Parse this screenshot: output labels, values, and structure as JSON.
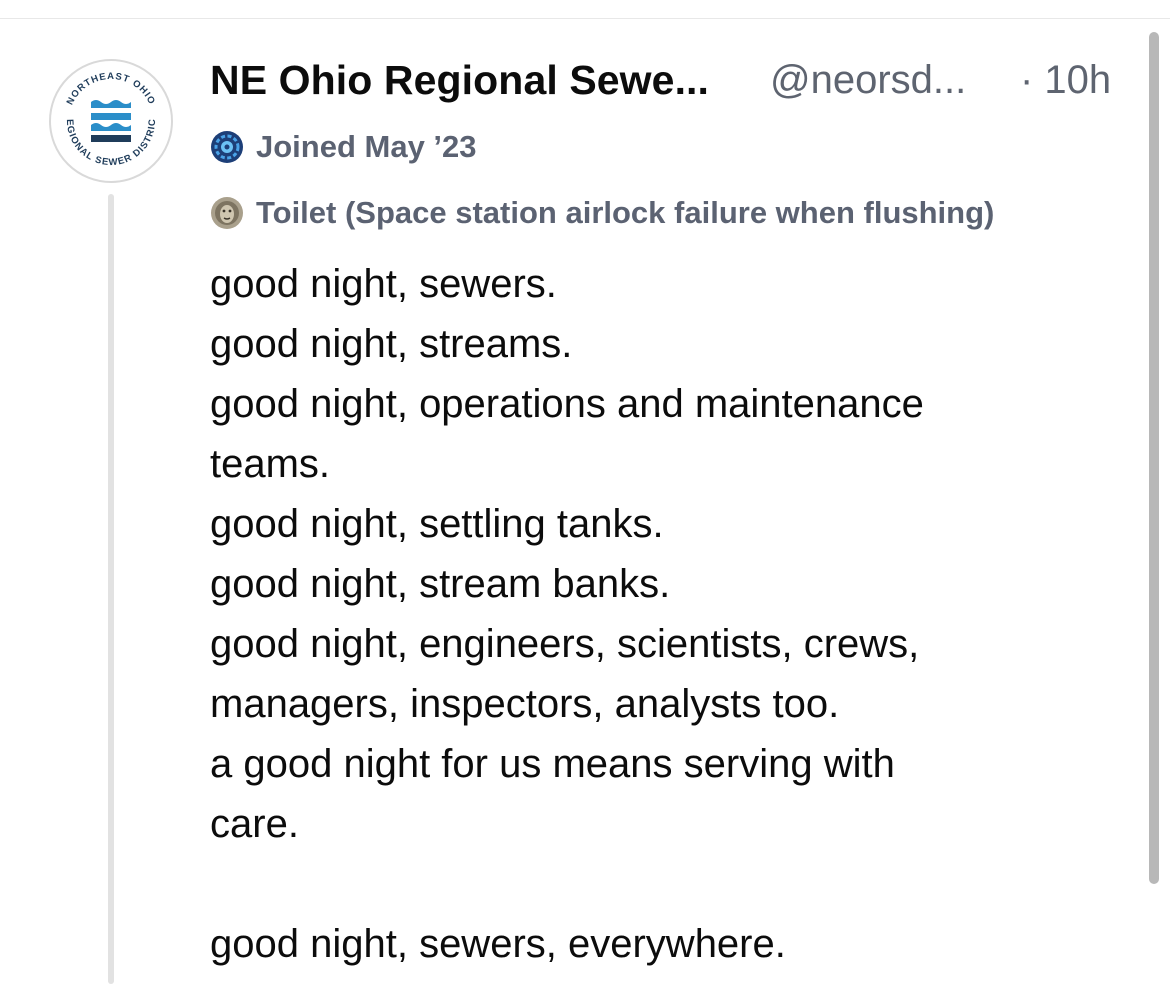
{
  "post": {
    "display_name": "NE Ohio Regional Sewe...",
    "handle": "@neorsd...",
    "time": "· 10h",
    "joined": "Joined May ’23",
    "joined_icon": "globe-badge-icon",
    "pronoun_icon": "lion-emoji-icon",
    "pronouns": "Toilet (Space station airlock failure when flushing)",
    "avatar": {
      "logo_text": "NORTHEAST OHIO REGIONAL SEWER DISTRICT",
      "logo_icon": "water-waves-icon"
    },
    "lines": [
      "good night, sewers.",
      "good night, streams.",
      "good night, operations and maintenance",
      "teams.",
      "good night, settling tanks.",
      "good night, stream banks.",
      "good night, engineers, scientists, crews,",
      "managers, inspectors, analysts too.",
      "a good night for us means serving with",
      "care.",
      "",
      "good night, sewers, everywhere."
    ]
  },
  "colors": {
    "text": "#0c0c0c",
    "muted": "#5e6470",
    "logo_blue": "#2b8ec9",
    "logo_navy": "#1f3c5a",
    "thread_line": "#e2e2e2"
  }
}
